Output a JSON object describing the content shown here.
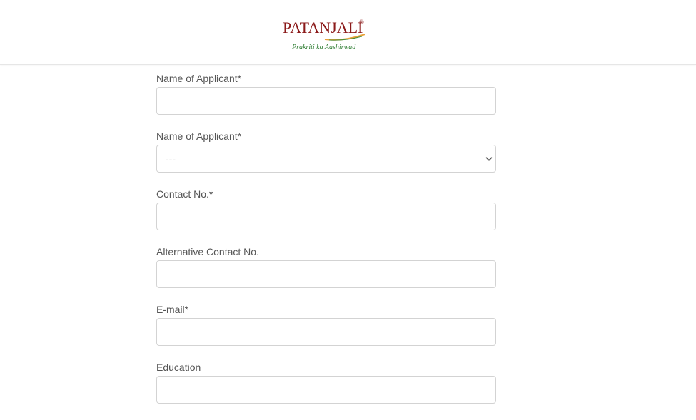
{
  "header": {
    "logo": {
      "brand": "PATANJALI",
      "registered_mark": "®",
      "tagline": "Prakriti ka Aashirwad"
    }
  },
  "form": {
    "fields": [
      {
        "label": "Name of Applicant*",
        "type": "text",
        "value": ""
      },
      {
        "label": "Name of Applicant*",
        "type": "select",
        "selected": "---"
      },
      {
        "label": "Contact No.*",
        "type": "text",
        "value": ""
      },
      {
        "label": "Alternative Contact No.",
        "type": "text",
        "value": ""
      },
      {
        "label": "E-mail*",
        "type": "text",
        "value": ""
      },
      {
        "label": "Education",
        "type": "text",
        "value": ""
      }
    ]
  },
  "colors": {
    "brand_red": "#8b1a1a",
    "tagline_green": "#2e7d32",
    "swoosh_orange": "#e8a23a",
    "label_gray": "#555555",
    "border_gray": "#d3d3d3"
  }
}
